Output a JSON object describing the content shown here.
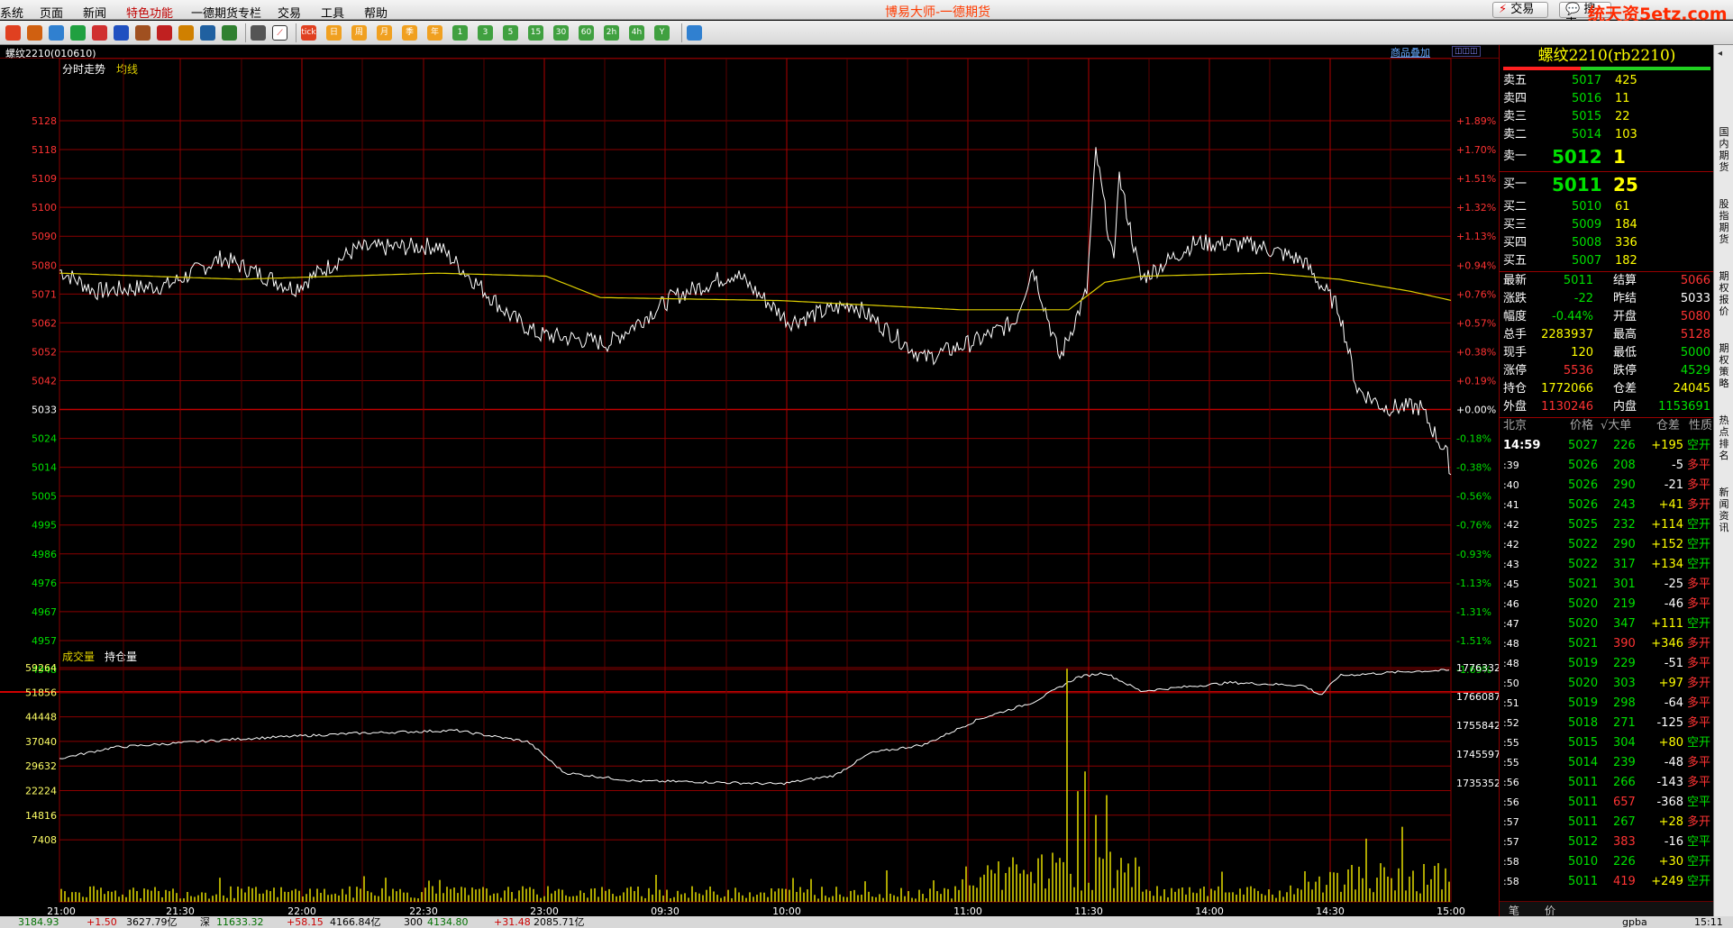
{
  "menu": {
    "items": [
      "系统",
      "页面",
      "新闻",
      "特色功能",
      "一德期货专栏",
      "交易",
      "工具",
      "帮助"
    ],
    "title": "博易大师-一德期货",
    "trade_btn": "交易",
    "extra_btn": "搜索"
  },
  "watermark": "统天资5etz.com",
  "toolbar": {
    "icons": [
      "home-icon",
      "folder-icon",
      "layout-icon",
      "refresh-icon",
      "zoom-in-icon",
      "zoom-out-icon",
      "window-icon",
      "pen-icon",
      "chart-icon",
      "filter-icon",
      "link-icon",
      "table-icon",
      "trend-icon",
      "tick-icon",
      "day-icon",
      "week-icon",
      "month-icon",
      "season-icon",
      "year-icon",
      "1min-icon",
      "3min-icon",
      "5min-icon",
      "15min-icon",
      "30min-icon",
      "60min-icon",
      "2h-icon",
      "4h-icon",
      "custom-period-icon",
      "calc-icon"
    ],
    "labels": [
      "tick",
      "日",
      "周",
      "月",
      "季",
      "年",
      "1",
      "3",
      "5",
      "15",
      "30",
      "60",
      "2h",
      "4h",
      "Y"
    ]
  },
  "chart": {
    "code_title": "螺纹2210(010610)",
    "overlay_link": "商品叠加",
    "price_legend": [
      "分时走势",
      "均线"
    ],
    "price_ticks_left": [
      "5128",
      "5118",
      "5109",
      "5100",
      "5090",
      "5080",
      "5071",
      "5062",
      "5052",
      "5042",
      "5033",
      "5024",
      "5014",
      "5005",
      "4995",
      "4986",
      "4976",
      "4967",
      "4957",
      "4948"
    ],
    "price_ticks_right": [
      "+1.89%",
      "+1.70%",
      "+1.51%",
      "+1.32%",
      "+1.13%",
      "+0.94%",
      "+0.76%",
      "+0.57%",
      "+0.38%",
      "+0.19%",
      "+0.00%",
      "-0.18%",
      "-0.38%",
      "-0.56%",
      "-0.76%",
      "-0.93%",
      "-1.13%",
      "-1.31%",
      "-1.51%",
      "-1.69%"
    ],
    "vol_legend": [
      "成交量",
      "持仓量"
    ],
    "vol_ticks_left": [
      "59264",
      "51856",
      "44448",
      "37040",
      "29632",
      "22224",
      "14816",
      "7408"
    ],
    "oi_ticks_right": [
      "1776332",
      "1766087",
      "1755842",
      "1745597",
      "1735352"
    ],
    "time_labels": [
      "21:00",
      "21:30",
      "22:00",
      "22:30",
      "23:00",
      "09:30",
      "10:00",
      "11:00",
      "11:30",
      "14:00",
      "14:30",
      "15:00"
    ]
  },
  "chart_data": {
    "type": "line",
    "title": "分时走势",
    "x": [
      "21:00",
      "21:30",
      "22:00",
      "22:30",
      "23:00",
      "09:30",
      "10:00",
      "11:00",
      "11:30",
      "14:00",
      "14:30",
      "15:00"
    ],
    "price_range": [
      4948,
      5128
    ],
    "prev_settle": 5033,
    "price_series_approx": [
      5078,
      5075,
      5082,
      5085,
      5080,
      5058,
      5068,
      5070,
      5064,
      5052,
      5115,
      5083,
      5085,
      5080,
      5045,
      5025,
      5040,
      5011
    ],
    "avg_series_approx": [
      5077,
      5077,
      5078,
      5079,
      5078,
      5071,
      5070,
      5069,
      5068,
      5067,
      5078,
      5079,
      5079,
      5078,
      5075,
      5068
    ],
    "volume_range": [
      0,
      59264
    ],
    "open_interest_range": [
      1735352,
      1776332
    ]
  },
  "quote": {
    "title": "螺纹2210(rb2210)",
    "asks": [
      {
        "label": "卖五",
        "price": "5017",
        "vol": "425"
      },
      {
        "label": "卖四",
        "price": "5016",
        "vol": "11"
      },
      {
        "label": "卖三",
        "price": "5015",
        "vol": "22"
      },
      {
        "label": "卖二",
        "price": "5014",
        "vol": "103"
      },
      {
        "label": "卖一",
        "price": "5012",
        "vol": "1"
      }
    ],
    "bids": [
      {
        "label": "买一",
        "price": "5011",
        "vol": "25"
      },
      {
        "label": "买二",
        "price": "5010",
        "vol": "61"
      },
      {
        "label": "买三",
        "price": "5009",
        "vol": "184"
      },
      {
        "label": "买四",
        "price": "5008",
        "vol": "336"
      },
      {
        "label": "买五",
        "price": "5007",
        "vol": "182"
      }
    ],
    "stats": [
      [
        "最新",
        "5011",
        "结算",
        "5066"
      ],
      [
        "涨跌",
        "-22",
        "昨结",
        "5033"
      ],
      [
        "幅度",
        "-0.44%",
        "开盘",
        "5080"
      ],
      [
        "总手",
        "2283937",
        "最高",
        "5128"
      ],
      [
        "现手",
        "120",
        "最低",
        "5000"
      ],
      [
        "涨停",
        "5536",
        "跌停",
        "4529"
      ],
      [
        "持仓",
        "1772066",
        "仓差",
        "24045"
      ],
      [
        "外盘",
        "1130246",
        "内盘",
        "1153691"
      ]
    ],
    "tick_header": [
      "北京",
      "价格",
      "√大单",
      "仓差",
      "性质"
    ],
    "ticks": [
      [
        "14:59",
        "5027",
        "226",
        "+195",
        "空开"
      ],
      [
        ":39",
        "5026",
        "208",
        "-5",
        "多平"
      ],
      [
        ":40",
        "5026",
        "290",
        "-21",
        "多平"
      ],
      [
        ":41",
        "5026",
        "243",
        "+41",
        "多开"
      ],
      [
        ":42",
        "5025",
        "232",
        "+114",
        "空开"
      ],
      [
        ":42",
        "5022",
        "290",
        "+152",
        "空开"
      ],
      [
        ":43",
        "5022",
        "317",
        "+134",
        "空开"
      ],
      [
        ":45",
        "5021",
        "301",
        "-25",
        "多平"
      ],
      [
        ":46",
        "5020",
        "219",
        "-46",
        "多平"
      ],
      [
        ":47",
        "5020",
        "347",
        "+111",
        "空开"
      ],
      [
        ":48",
        "5021",
        "390",
        "+346",
        "多开"
      ],
      [
        ":48",
        "5019",
        "229",
        "-51",
        "多平"
      ],
      [
        ":50",
        "5020",
        "303",
        "+97",
        "多开"
      ],
      [
        ":51",
        "5019",
        "298",
        "-64",
        "多平"
      ],
      [
        ":52",
        "5018",
        "271",
        "-125",
        "多平"
      ],
      [
        ":55",
        "5015",
        "304",
        "+80",
        "空开"
      ],
      [
        ":55",
        "5014",
        "239",
        "-48",
        "多平"
      ],
      [
        ":56",
        "5011",
        "266",
        "-143",
        "多平"
      ],
      [
        ":56",
        "5011",
        "657",
        "-368",
        "空平"
      ],
      [
        ":57",
        "5011",
        "267",
        "+28",
        "多开"
      ],
      [
        ":57",
        "5012",
        "383",
        "-16",
        "空平"
      ],
      [
        ":58",
        "5010",
        "226",
        "+30",
        "空开"
      ],
      [
        ":58",
        "5011",
        "419",
        "+249",
        "空开"
      ]
    ],
    "bottom_tabs": [
      "笔",
      "价"
    ]
  },
  "right_tabs": [
    "国内期货",
    "股指期货",
    "期权报价",
    "期权策略",
    "热点排名",
    "新闻资讯"
  ],
  "status": [
    "3184.93",
    "+1.50",
    "3627.79亿",
    "深",
    "11633.32",
    "+58.15",
    "4166.84亿",
    "300",
    "4134.80",
    "+31.48",
    "2085.71亿",
    "gpba",
    "15:11"
  ],
  "colors": {
    "up": "#ff3333",
    "down": "#00e000",
    "grid": "#8b0000",
    "price_line": "#ffffff",
    "avg_line": "#e0d000",
    "volume_bar": "#d8d000",
    "ticker_yellow": "#ffff00"
  }
}
